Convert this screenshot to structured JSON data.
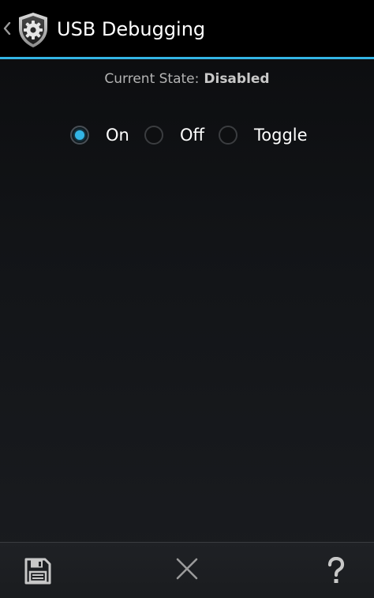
{
  "action_bar": {
    "title": "USB Debugging",
    "back_icon": "chevron-left-icon",
    "app_icon": "shield-gear-icon"
  },
  "state": {
    "label": "Current State:",
    "value": "Disabled"
  },
  "radio_options": [
    {
      "label": "On",
      "checked": true
    },
    {
      "label": "Off",
      "checked": false
    },
    {
      "label": "Toggle",
      "checked": false
    }
  ],
  "bottom_bar": {
    "save_icon": "floppy-disk-icon",
    "cancel_icon": "close-icon",
    "help_icon": "question-mark-icon"
  },
  "colors": {
    "accent": "#33b5e5",
    "action_bar_bg": "#000000",
    "content_bg": "#121417"
  }
}
